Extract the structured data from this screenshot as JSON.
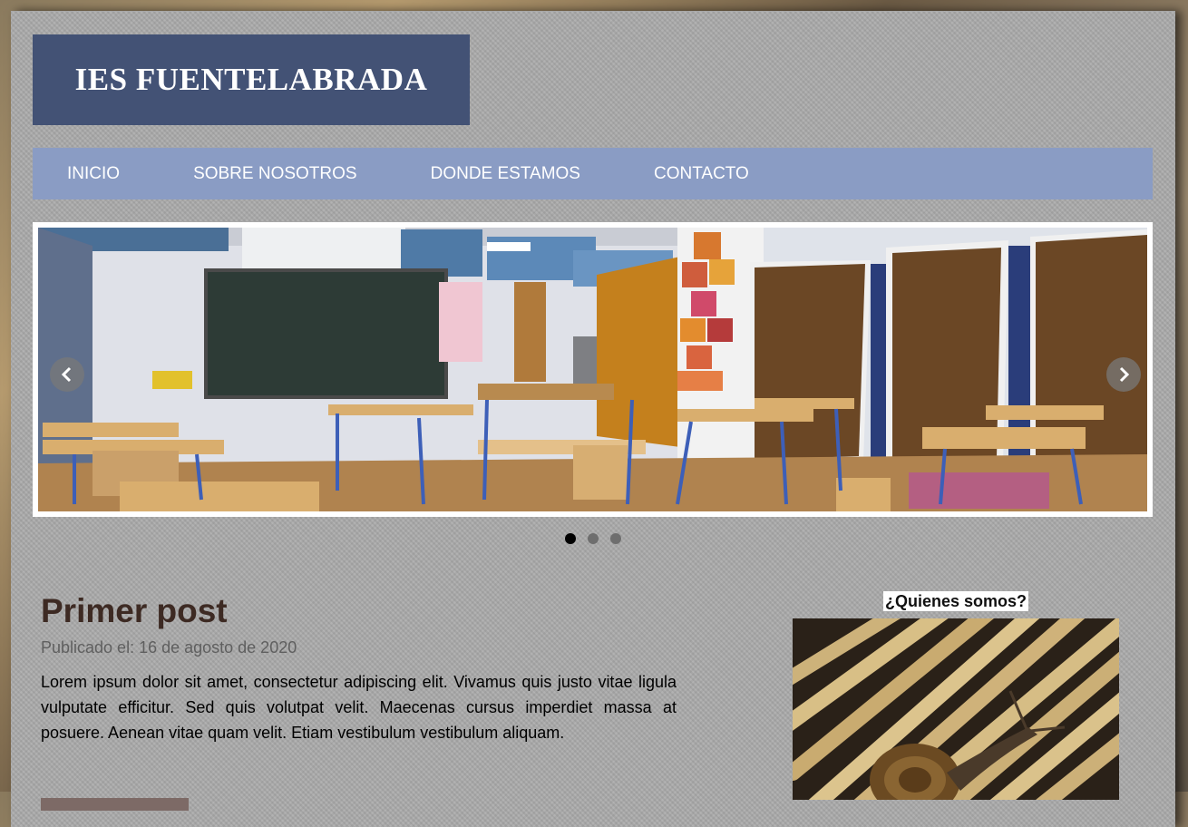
{
  "header": {
    "site_title": "IES FUENTELABRADA"
  },
  "nav": {
    "items": [
      {
        "label": "INICIO"
      },
      {
        "label": "SOBRE NOSOTROS"
      },
      {
        "label": "DONDE ESTAMOS"
      },
      {
        "label": "CONTACTO"
      }
    ]
  },
  "slider": {
    "prev_icon": "chevron-left-icon",
    "next_icon": "chevron-right-icon",
    "slide_count": 3,
    "active_slide": 1
  },
  "post": {
    "title": "Primer post",
    "date": "Publicado el: 16 de agosto de 2020",
    "body": "Lorem ipsum dolor sit amet, consectetur adipiscing elit. Vivamus quis justo vitae ligula vulputate efficitur. Sed quis volutpat velit. Maecenas cursus imperdiet massa at posuere. Aenean vitae quam velit. Etiam vestibulum vestibulum aliquam."
  },
  "sidebar": {
    "title": "¿Quienes somos?"
  },
  "colors": {
    "title_box": "#435275",
    "nav_bar": "#8a9cc4",
    "post_title": "#3d2a23",
    "button": "#7d6a66"
  }
}
